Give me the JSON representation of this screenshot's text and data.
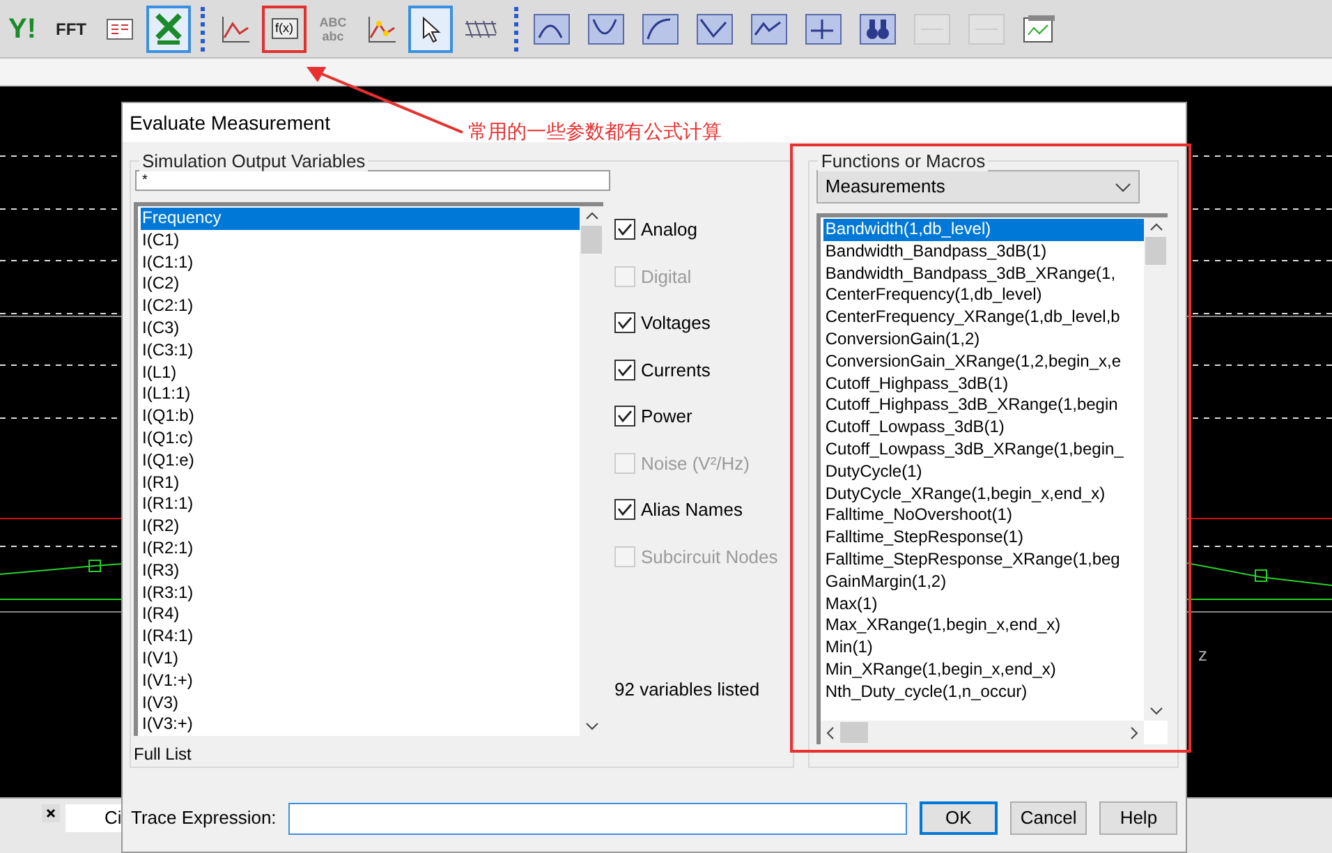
{
  "toolbar": {
    "items": [
      {
        "kind": "text",
        "label": "Y!",
        "selected": false
      },
      {
        "kind": "text",
        "label": "FFT",
        "selected": false
      },
      {
        "kind": "icon",
        "selected": false
      },
      {
        "kind": "icon",
        "selected": true
      },
      {
        "kind": "sep"
      },
      {
        "kind": "icon",
        "selected": false
      },
      {
        "kind": "text",
        "label": "f(x)",
        "selected": false,
        "highlighted": true
      },
      {
        "kind": "text",
        "label": "ABC abc",
        "selected": false
      },
      {
        "kind": "icon",
        "selected": false
      },
      {
        "kind": "icon",
        "selected": true
      },
      {
        "kind": "icon",
        "selected": false
      },
      {
        "kind": "sep"
      },
      {
        "kind": "icon",
        "selected": false
      },
      {
        "kind": "icon",
        "selected": false
      },
      {
        "kind": "icon",
        "selected": false
      },
      {
        "kind": "icon",
        "selected": false
      },
      {
        "kind": "icon",
        "selected": false
      },
      {
        "kind": "icon",
        "selected": false
      },
      {
        "kind": "icon",
        "selected": false
      },
      {
        "kind": "icon",
        "selected": false
      },
      {
        "kind": "icon",
        "selected": false
      },
      {
        "kind": "icon",
        "selected": false
      }
    ]
  },
  "annotation": {
    "text": "常用的一些参数都有公式计算"
  },
  "plot": {
    "axis_fragment": "z"
  },
  "bottom_panel": {
    "text": "Ci"
  },
  "dialog": {
    "title": "Evaluate Measurement",
    "variables_group": {
      "label": "Simulation Output Variables",
      "filter": "*",
      "items": [
        {
          "text": "Frequency",
          "selected": true
        },
        {
          "text": "I(C1)",
          "selected": false
        },
        {
          "text": "I(C1:1)",
          "selected": false
        },
        {
          "text": "I(C2)",
          "selected": false
        },
        {
          "text": "I(C2:1)",
          "selected": false
        },
        {
          "text": "I(C3)",
          "selected": false
        },
        {
          "text": "I(C3:1)",
          "selected": false
        },
        {
          "text": "I(L1)",
          "selected": false
        },
        {
          "text": "I(L1:1)",
          "selected": false
        },
        {
          "text": "I(Q1:b)",
          "selected": false
        },
        {
          "text": "I(Q1:c)",
          "selected": false
        },
        {
          "text": "I(Q1:e)",
          "selected": false
        },
        {
          "text": "I(R1)",
          "selected": false
        },
        {
          "text": "I(R1:1)",
          "selected": false
        },
        {
          "text": "I(R2)",
          "selected": false
        },
        {
          "text": "I(R2:1)",
          "selected": false
        },
        {
          "text": "I(R3)",
          "selected": false
        },
        {
          "text": "I(R3:1)",
          "selected": false
        },
        {
          "text": "I(R4)",
          "selected": false
        },
        {
          "text": "I(R4:1)",
          "selected": false
        },
        {
          "text": "I(V1)",
          "selected": false
        },
        {
          "text": "I(V1:+)",
          "selected": false
        },
        {
          "text": "I(V3)",
          "selected": false
        },
        {
          "text": "I(V3:+)",
          "selected": false
        }
      ],
      "options": [
        {
          "label": "Analog",
          "checked": true,
          "disabled": false
        },
        {
          "label": "Digital",
          "checked": false,
          "disabled": true
        },
        {
          "label": "Voltages",
          "checked": true,
          "disabled": false
        },
        {
          "label": "Currents",
          "checked": true,
          "disabled": false
        },
        {
          "label": "Power",
          "checked": true,
          "disabled": false
        },
        {
          "label": "Noise (V²/Hz)",
          "checked": false,
          "disabled": true
        },
        {
          "label": "Alias Names",
          "checked": true,
          "disabled": false
        },
        {
          "label": "Subcircuit Nodes",
          "checked": false,
          "disabled": true
        }
      ],
      "count": "92 variables listed",
      "footer": "Full List"
    },
    "functions_group": {
      "label": "Functions or Macros",
      "category": "Measurements",
      "items": [
        {
          "text": "Bandwidth(1,db_level)",
          "selected": true
        },
        {
          "text": "Bandwidth_Bandpass_3dB(1)",
          "selected": false
        },
        {
          "text": "Bandwidth_Bandpass_3dB_XRange(1,",
          "selected": false
        },
        {
          "text": "CenterFrequency(1,db_level)",
          "selected": false
        },
        {
          "text": "CenterFrequency_XRange(1,db_level,b",
          "selected": false
        },
        {
          "text": "ConversionGain(1,2)",
          "selected": false
        },
        {
          "text": "ConversionGain_XRange(1,2,begin_x,e",
          "selected": false
        },
        {
          "text": "Cutoff_Highpass_3dB(1)",
          "selected": false
        },
        {
          "text": "Cutoff_Highpass_3dB_XRange(1,begin",
          "selected": false
        },
        {
          "text": "Cutoff_Lowpass_3dB(1)",
          "selected": false
        },
        {
          "text": "Cutoff_Lowpass_3dB_XRange(1,begin_",
          "selected": false
        },
        {
          "text": "DutyCycle(1)",
          "selected": false
        },
        {
          "text": "DutyCycle_XRange(1,begin_x,end_x)",
          "selected": false
        },
        {
          "text": "Falltime_NoOvershoot(1)",
          "selected": false
        },
        {
          "text": "Falltime_StepResponse(1)",
          "selected": false
        },
        {
          "text": "Falltime_StepResponse_XRange(1,beg",
          "selected": false
        },
        {
          "text": "GainMargin(1,2)",
          "selected": false
        },
        {
          "text": "Max(1)",
          "selected": false
        },
        {
          "text": "Max_XRange(1,begin_x,end_x)",
          "selected": false
        },
        {
          "text": "Min(1)",
          "selected": false
        },
        {
          "text": "Min_XRange(1,begin_x,end_x)",
          "selected": false
        },
        {
          "text": "Nth_Duty_cycle(1,n_occur)",
          "selected": false
        }
      ]
    },
    "trace_label": "Trace Expression:",
    "buttons": [
      {
        "label": "OK",
        "default": true
      },
      {
        "label": "Cancel",
        "default": false
      },
      {
        "label": "Help",
        "default": false
      }
    ]
  }
}
